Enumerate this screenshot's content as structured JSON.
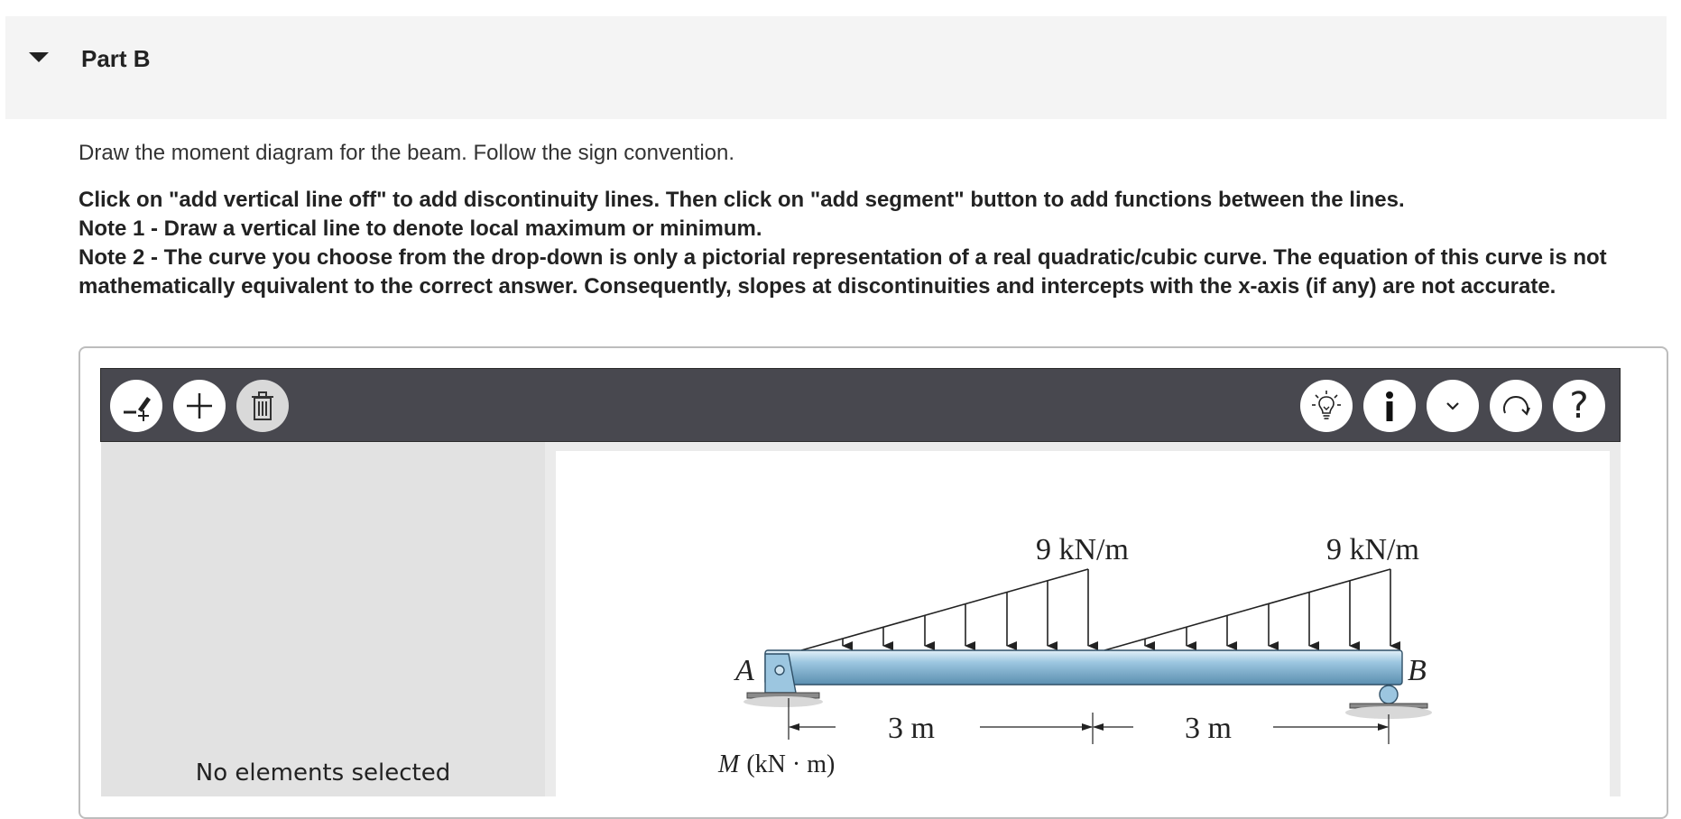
{
  "part": {
    "title": "Part B",
    "toggle_icon": "caret-down-icon"
  },
  "instruction": "Draw the moment diagram for the beam. Follow the sign convention.",
  "notes": [
    "Click on \"add vertical line off\" to add discontinuity lines. Then click on \"add segment\" button to add functions between the lines.",
    "Note 1 - Draw a vertical line to denote local maximum or minimum.",
    "Note 2 - The curve you choose from the drop-down is only a pictorial representation of a real quadratic/cubic curve. The equation of this curve is not mathematically equivalent to the correct answer. Consequently, slopes at discontinuities and intercepts with the x-axis (if any) are not accurate."
  ],
  "toolbar": {
    "left_icons": [
      "add-vertical-line-icon",
      "add-segment-icon",
      "delete-icon"
    ],
    "right_icons": [
      "hint-lightbulb-icon",
      "info-icon",
      "dropdown-chevron-icon",
      "reset-icon",
      "help-icon"
    ],
    "help_glyph": "?"
  },
  "panel": {
    "status": "No elements selected"
  },
  "figure": {
    "load_left": "9 kN/m",
    "load_right": "9 kN/m",
    "label_a": "A",
    "label_b": "B",
    "dim_left": "3 m",
    "dim_right": "3 m",
    "axis_label_var": "M",
    "axis_label_unit": "(kN · m)",
    "beam_color": "#9cc6e0"
  }
}
